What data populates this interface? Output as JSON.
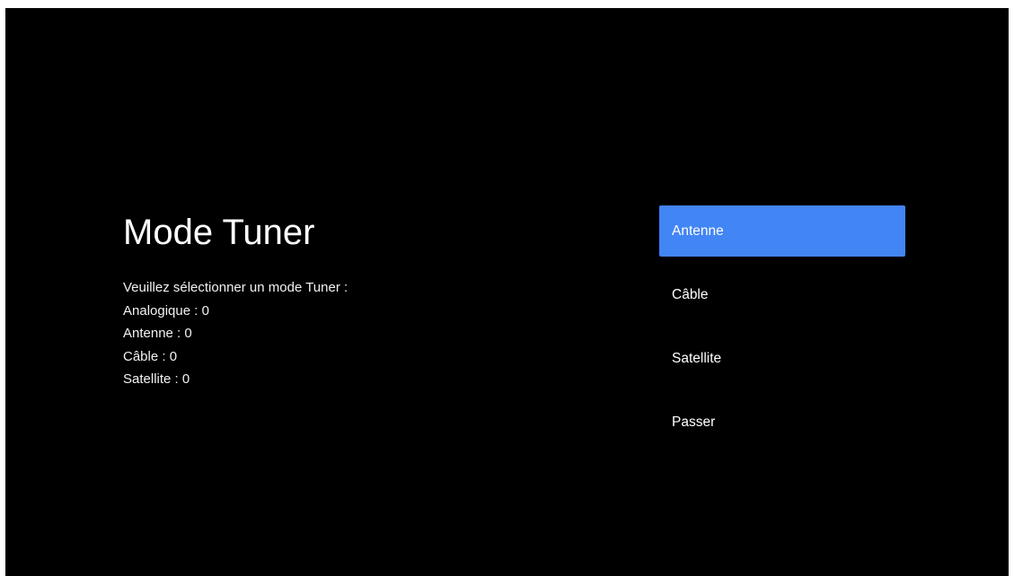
{
  "colors": {
    "background": "#000000",
    "accent": "#4285f4",
    "text": "#ffffff"
  },
  "header": {
    "title": "Mode Tuner"
  },
  "description": {
    "prompt": "Veuillez sélectionner un mode Tuner :",
    "lines": [
      "Analogique : 0",
      "Antenne : 0",
      "Câble : 0",
      "Satellite : 0"
    ]
  },
  "menu": {
    "items": [
      {
        "label": "Antenne",
        "selected": true
      },
      {
        "label": "Câble",
        "selected": false
      },
      {
        "label": "Satellite",
        "selected": false
      },
      {
        "label": "Passer",
        "selected": false
      }
    ]
  }
}
